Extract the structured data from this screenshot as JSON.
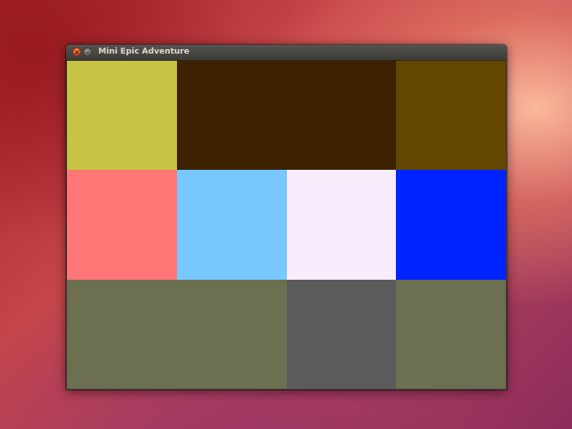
{
  "window": {
    "title": "Mini Epic Adventure",
    "close_symbol": "×",
    "minimize_symbol": "–"
  },
  "tiles": [
    {
      "row": 1,
      "col": 1,
      "colspan": 1,
      "color": "#c8c443"
    },
    {
      "row": 1,
      "col": 2,
      "colspan": 2,
      "color": "#3d2200"
    },
    {
      "row": 1,
      "col": 4,
      "colspan": 1,
      "color": "#634600"
    },
    {
      "row": 2,
      "col": 1,
      "colspan": 1,
      "color": "#ff7676"
    },
    {
      "row": 2,
      "col": 2,
      "colspan": 1,
      "color": "#78c8ff"
    },
    {
      "row": 2,
      "col": 3,
      "colspan": 1,
      "color": "#f8ebfb"
    },
    {
      "row": 2,
      "col": 4,
      "colspan": 1,
      "color": "#0024ff"
    },
    {
      "row": 3,
      "col": 1,
      "colspan": 2,
      "color": "#6c6f50"
    },
    {
      "row": 3,
      "col": 3,
      "colspan": 1,
      "color": "#5b5b5b"
    },
    {
      "row": 3,
      "col": 4,
      "colspan": 1,
      "color": "#6c6f50"
    }
  ]
}
